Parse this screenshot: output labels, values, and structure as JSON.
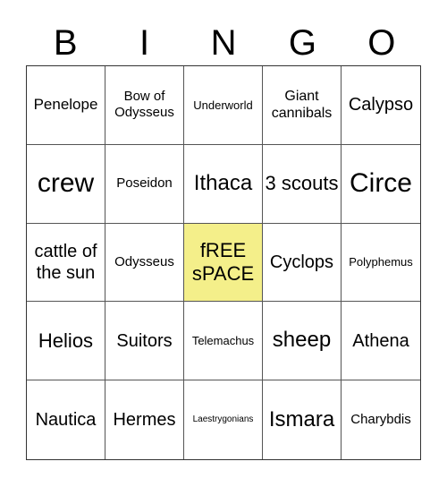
{
  "header": [
    "B",
    "I",
    "N",
    "G",
    "O"
  ],
  "cells": [
    {
      "text": "Penelope",
      "size": "s17"
    },
    {
      "text": "Bow of Odysseus",
      "size": "s15"
    },
    {
      "text": "Underworld",
      "size": "s13"
    },
    {
      "text": "Giant cannibals",
      "size": "s16"
    },
    {
      "text": "Calypso",
      "size": "s20"
    },
    {
      "text": "crew",
      "size": "s30"
    },
    {
      "text": "Poseidon",
      "size": "s15"
    },
    {
      "text": "Ithaca",
      "size": "s24"
    },
    {
      "text": "3 scouts",
      "size": "s22"
    },
    {
      "text": "Circe",
      "size": "s30"
    },
    {
      "text": "cattle of the sun",
      "size": "s20"
    },
    {
      "text": "Odysseus",
      "size": "s15"
    },
    {
      "text": "fREE sPACE",
      "size": "s22",
      "free": true
    },
    {
      "text": "Cyclops",
      "size": "s20"
    },
    {
      "text": "Polyphemus",
      "size": "s13"
    },
    {
      "text": "Helios",
      "size": "s22"
    },
    {
      "text": "Suitors",
      "size": "s20"
    },
    {
      "text": "Telemachus",
      "size": "s13"
    },
    {
      "text": "sheep",
      "size": "s24"
    },
    {
      "text": "Athena",
      "size": "s20"
    },
    {
      "text": "Nautica",
      "size": "s20"
    },
    {
      "text": "Hermes",
      "size": "s20"
    },
    {
      "text": "Laestrygonians",
      "size": "s9"
    },
    {
      "text": "Ismara",
      "size": "s24"
    },
    {
      "text": "Charybdis",
      "size": "s15"
    }
  ],
  "colors": {
    "free_space": "#f4ef8a"
  }
}
